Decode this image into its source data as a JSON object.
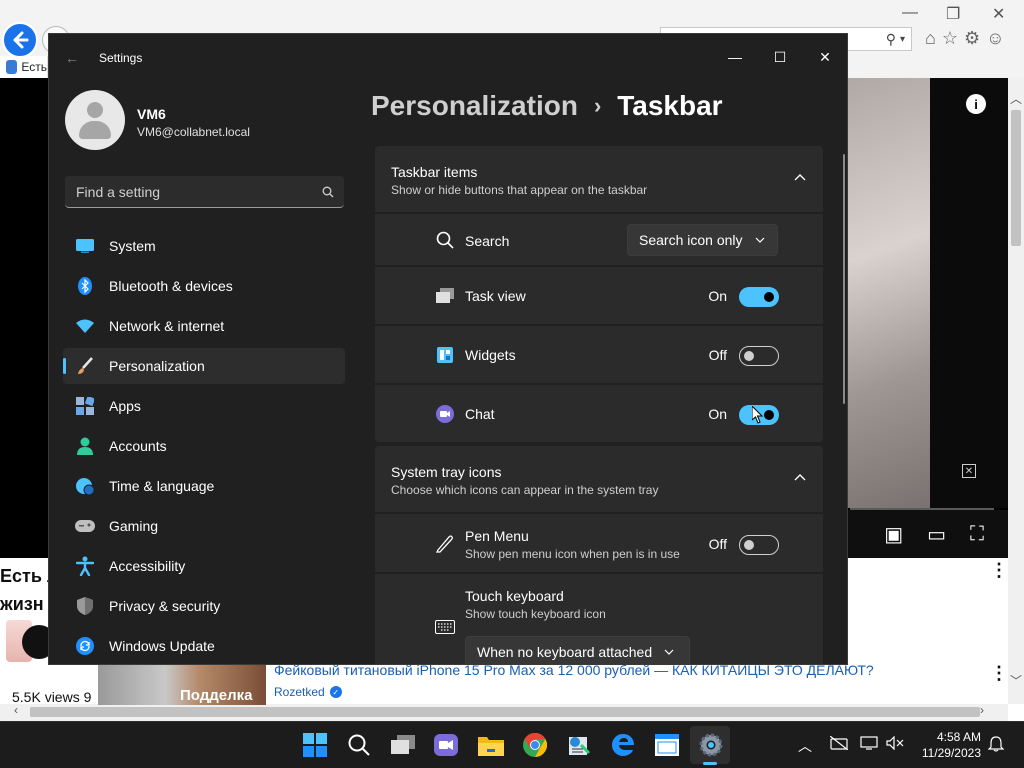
{
  "browser": {
    "tab_title": "Есть",
    "video_side_title_line1": "Есть л",
    "video_side_title_line2": "жизн",
    "views": "5.5K views  9",
    "related_title": "Фейковый титановый iPhone 15 Pro Max за 12 000 рублей — КАК КИТАЙЦЫ ЭТО ДЕЛАЮТ?",
    "related_thumb_text": "Подделка",
    "related_channel": "Rozetked"
  },
  "settings": {
    "window_title": "Settings",
    "profile": {
      "name": "VM6",
      "email": "VM6@collabnet.local"
    },
    "search": {
      "placeholder": "Find a setting"
    },
    "nav": [
      {
        "label": "System",
        "icon": "monitor-icon",
        "color": "#4cc2ff"
      },
      {
        "label": "Bluetooth & devices",
        "icon": "bluetooth-icon",
        "color": "#1e90ff"
      },
      {
        "label": "Network & internet",
        "icon": "wifi-icon",
        "color": "#4cc2ff"
      },
      {
        "label": "Personalization",
        "icon": "brush-icon",
        "color": "#e8a060",
        "active": true
      },
      {
        "label": "Apps",
        "icon": "apps-icon",
        "color": "#6aa6e8"
      },
      {
        "label": "Accounts",
        "icon": "person-icon",
        "color": "#2ecc9a"
      },
      {
        "label": "Time & language",
        "icon": "globe-clock-icon",
        "color": "#4cc2ff"
      },
      {
        "label": "Gaming",
        "icon": "gamepad-icon",
        "color": "#bfbfbf"
      },
      {
        "label": "Accessibility",
        "icon": "accessibility-icon",
        "color": "#4cc2ff"
      },
      {
        "label": "Privacy & security",
        "icon": "shield-icon",
        "color": "#9a9a9a"
      },
      {
        "label": "Windows Update",
        "icon": "update-icon",
        "color": "#1e90ff"
      }
    ],
    "breadcrumb": {
      "parent": "Personalization",
      "separator": "›",
      "current": "Taskbar"
    },
    "taskbar_items": {
      "title": "Taskbar items",
      "subtitle": "Show or hide buttons that appear on the taskbar",
      "search": {
        "label": "Search",
        "value": "Search icon only"
      },
      "task_view": {
        "label": "Task view",
        "state": "On"
      },
      "widgets": {
        "label": "Widgets",
        "state": "Off"
      },
      "chat": {
        "label": "Chat",
        "state": "On"
      }
    },
    "system_tray": {
      "title": "System tray icons",
      "subtitle": "Choose which icons can appear in the system tray",
      "pen_menu": {
        "label": "Pen Menu",
        "sub": "Show pen menu icon when pen is in use",
        "state": "Off"
      },
      "touch_keyboard": {
        "label": "Touch keyboard",
        "sub": "Show touch keyboard icon",
        "value": "When no keyboard attached"
      }
    },
    "accent": "#4cc2ff"
  },
  "taskbar": {
    "time": "4:58 AM",
    "date": "11/29/2023",
    "apps": [
      "start-icon",
      "search-icon",
      "task-view-icon",
      "teams-chat-icon",
      "file-explorer-icon",
      "chrome-icon",
      "app-icon",
      "edge-legacy-icon",
      "notepad-icon",
      "settings-icon"
    ]
  }
}
